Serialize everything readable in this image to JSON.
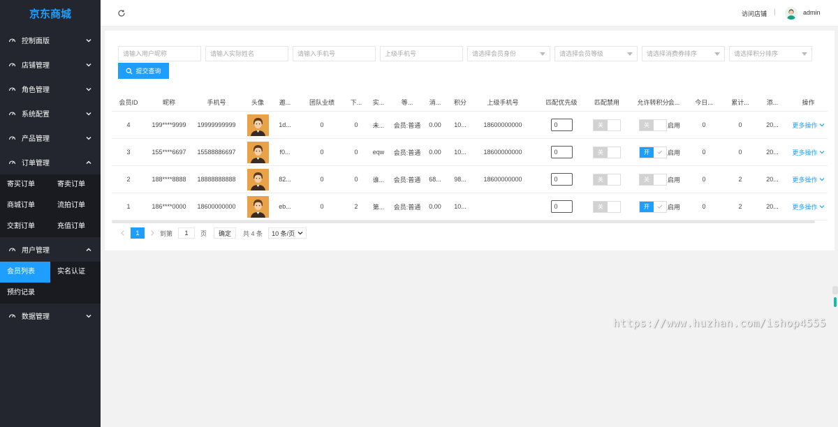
{
  "logo": "京东商城",
  "sidebar": {
    "items": [
      {
        "label": "控制面版",
        "icon": "dashboard-icon"
      },
      {
        "label": "店铺管理",
        "icon": "dashboard-icon"
      },
      {
        "label": "角色管理",
        "icon": "dashboard-icon"
      },
      {
        "label": "系统配置",
        "icon": "dashboard-icon"
      },
      {
        "label": "产品管理",
        "icon": "dashboard-icon"
      },
      {
        "label": "订单管理",
        "icon": "dashboard-icon"
      },
      {
        "label": "用户管理",
        "icon": "dashboard-icon"
      },
      {
        "label": "数据管理",
        "icon": "dashboard-icon"
      }
    ],
    "order_sub": [
      "寄买订单",
      "寄卖订单",
      "商城订单",
      "流拍订单",
      "交割订单",
      "充值订单"
    ],
    "user_sub": [
      "会员列表",
      "实名认证",
      "预约记录"
    ]
  },
  "header": {
    "visit_shop": "访问店铺",
    "separator": "|",
    "username": "admin"
  },
  "filters": {
    "nickname": "请输入用户昵称",
    "realname": "请输入实际姓名",
    "phone": "请输入手机号",
    "parent_phone": "上级手机号",
    "identity": "请选择会员身份",
    "level": "请选择会员等级",
    "coupon_sort": "请选择消费券排序",
    "points_sort": "请选择积分排序",
    "submit": "提交查询"
  },
  "table": {
    "headers": [
      "会员ID",
      "昵称",
      "手机号",
      "头像",
      "邀...",
      "团队业绩",
      "下...",
      "实...",
      "等...",
      "消...",
      "积分",
      "上级手机号",
      "匹配优先级",
      "匹配禁用",
      "允许转积分",
      "会...",
      "今日...",
      "累计...",
      "添...",
      "操作"
    ],
    "rows": [
      {
        "id": "4",
        "nick": "199****9999",
        "phone": "19999999999",
        "invite": "1d...",
        "team": "0",
        "sub": "0",
        "real": "未...",
        "grade": "会员:普通",
        "cons": "0.00",
        "points": "10...",
        "parent": "18600000000",
        "priority": "0",
        "match_label": "关",
        "transfer_label": "关",
        "transfer_on": false,
        "member": "启用",
        "today": "0",
        "total": "0",
        "added": "20...",
        "action": "更多操作"
      },
      {
        "id": "3",
        "nick": "155****6697",
        "phone": "15588886697",
        "invite": "f0...",
        "team": "0",
        "sub": "0",
        "real": "eqw",
        "grade": "会员:普通",
        "cons": "0.00",
        "points": "10...",
        "parent": "18600000000",
        "priority": "0",
        "match_label": "关",
        "transfer_label": "开",
        "transfer_on": true,
        "member": "启用",
        "today": "0",
        "total": "0",
        "added": "20...",
        "action": "更多操作"
      },
      {
        "id": "2",
        "nick": "188****8888",
        "phone": "18888888888",
        "invite": "82...",
        "team": "0",
        "sub": "0",
        "real": "谁...",
        "grade": "会员:普通",
        "cons": "68...",
        "points": "98...",
        "parent": "18600000000",
        "priority": "0",
        "match_label": "关",
        "transfer_label": "关",
        "transfer_on": false,
        "member": "启用",
        "today": "0",
        "total": "2",
        "added": "20...",
        "action": "更多操作"
      },
      {
        "id": "1",
        "nick": "186****0000",
        "phone": "18600000000",
        "invite": "eb...",
        "team": "0",
        "sub": "2",
        "real": "第...",
        "grade": "会员:普通",
        "cons": "0.00",
        "points": "10...",
        "parent": "",
        "priority": "0",
        "match_label": "关",
        "transfer_label": "开",
        "transfer_on": true,
        "member": "启用",
        "today": "0",
        "total": "2",
        "added": "20...",
        "action": "更多操作"
      }
    ]
  },
  "pager": {
    "current": "1",
    "goto": "到第",
    "goto_value": "1",
    "page_unit": "页",
    "confirm": "确定",
    "total": "共 4 条",
    "page_size": "10 条/页"
  },
  "watermark": "https://www.huzhan.com/ishop4555",
  "colors": {
    "accent": "#1e9fff",
    "sidebar": "#23262e",
    "logo": "#1e9fff"
  }
}
